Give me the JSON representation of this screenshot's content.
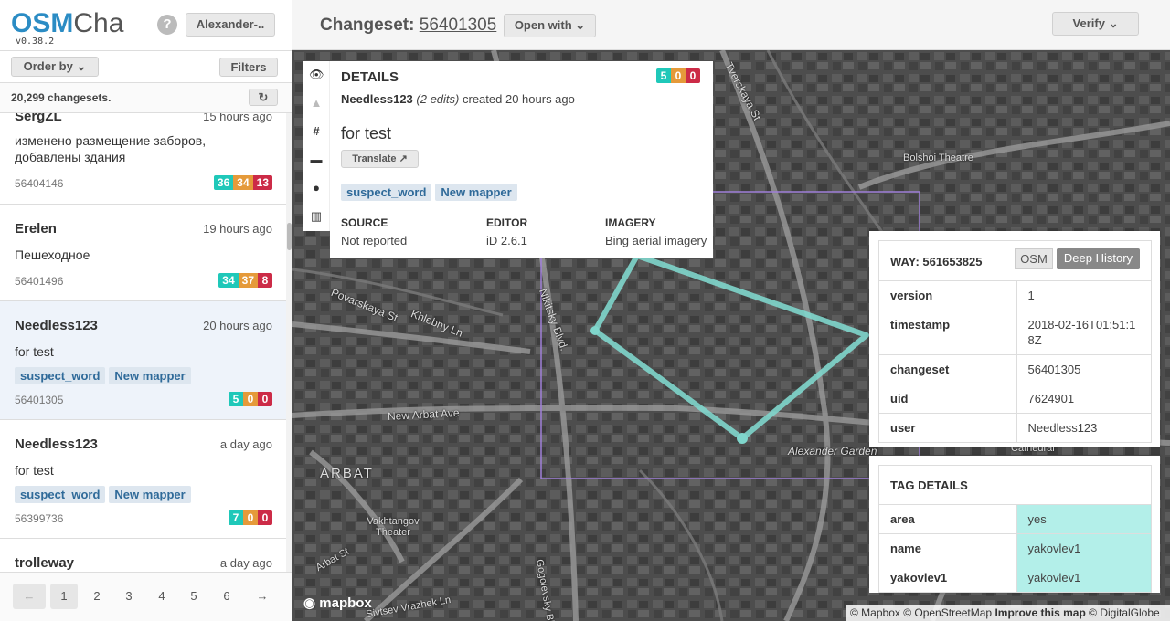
{
  "sidebar": {
    "brand_osm": "OSM",
    "brand_cha": "Cha",
    "version": "v0.38.2",
    "help_label": "?",
    "user_label": "Alexander-..",
    "order_by_label": "Order by",
    "filters_label": "Filters",
    "count_text": "20,299 changesets.",
    "refresh_icon": "↻",
    "changesets": [
      {
        "user": "SergZL",
        "time": "15 hours ago",
        "comment": "изменено размещение заборов, добавлены здания",
        "tags": [],
        "id": "56404146",
        "create": "36",
        "modify": "34",
        "delete": "13"
      },
      {
        "user": "Erelen",
        "time": "19 hours ago",
        "comment": "Пешеходное",
        "tags": [],
        "id": "56401496",
        "create": "34",
        "modify": "37",
        "delete": "8"
      },
      {
        "user": "Needless123",
        "time": "20 hours ago",
        "comment": "for test",
        "tags": [
          "suspect_word",
          "New mapper"
        ],
        "id": "56401305",
        "create": "5",
        "modify": "0",
        "delete": "0"
      },
      {
        "user": "Needless123",
        "time": "a day ago",
        "comment": "for test",
        "tags": [
          "suspect_word",
          "New mapper"
        ],
        "id": "56399736",
        "create": "7",
        "modify": "0",
        "delete": "0"
      },
      {
        "user": "trolleway",
        "time": "a day ago",
        "comment": "",
        "tags": [],
        "id": "",
        "create": "",
        "modify": "",
        "delete": ""
      }
    ],
    "pagination": {
      "prev": "←",
      "pages": [
        "1",
        "2",
        "3",
        "4",
        "5",
        "6"
      ],
      "next": "→"
    }
  },
  "header": {
    "title_prefix": "Changeset:",
    "changeset_id": "56401305",
    "open_with_label": "Open with",
    "verify_label": "Verify"
  },
  "details": {
    "title": "DETAILS",
    "counts": {
      "create": "5",
      "modify": "0",
      "delete": "0"
    },
    "user": "Needless123",
    "edits": "(2 edits)",
    "created": "created 20 hours ago",
    "comment": "for test",
    "translate_label": "Translate",
    "tags": [
      "suspect_word",
      "New mapper"
    ],
    "source_label": "SOURCE",
    "source_value": "Not reported",
    "editor_label": "EDITOR",
    "editor_value": "iD 2.6.1",
    "imagery_label": "IMAGERY",
    "imagery_value": "Bing aerial imagery"
  },
  "way": {
    "title": "WAY: 561653825",
    "osm_label": "OSM",
    "history_label": "Deep History",
    "rows": [
      {
        "k": "version",
        "v": "1"
      },
      {
        "k": "timestamp",
        "v": "2018-02-16T01:51:18Z"
      },
      {
        "k": "changeset",
        "v": "56401305"
      },
      {
        "k": "uid",
        "v": "7624901"
      },
      {
        "k": "user",
        "v": "Needless123"
      }
    ]
  },
  "tag_details": {
    "title": "TAG DETAILS",
    "rows": [
      {
        "k": "area",
        "v": "yes"
      },
      {
        "k": "name",
        "v": "yakovlev1"
      },
      {
        "k": "yakovlev1",
        "v": "yakovlev1"
      }
    ]
  },
  "map": {
    "labels": {
      "tverskaya": "Tverskaya St",
      "bolshoi": "Bolshoi Theatre",
      "povarskaya": "Povarskaya St",
      "khlebny": "Khlebny Ln",
      "nikitsky": "Nikitsky Blvd.",
      "new_arbat": "New Arbat Ave",
      "arbat": "ARBAT",
      "alexander": "Alexander Garden",
      "cathedral": "Cathedral",
      "vakhtangov": "Vakhtangov Theater",
      "arbat_st": "Arbat St",
      "sivtsev": "Sivtsev Vrazhek Ln",
      "gogolevsky": "Gogolevsky Blvd"
    },
    "logo": "mapbox",
    "attribution_a": "© Mapbox © OpenStreetMap",
    "attribution_b": "Improve this map",
    "attribution_c": "© DigitalGlobe"
  },
  "colors": {
    "brand": "#2b8cc4",
    "create": "#1fc8b9",
    "modify": "#e59a3a",
    "delete": "#cc2b47",
    "way_line": "#7fd6cc",
    "bbox": "#9f7fd8"
  }
}
